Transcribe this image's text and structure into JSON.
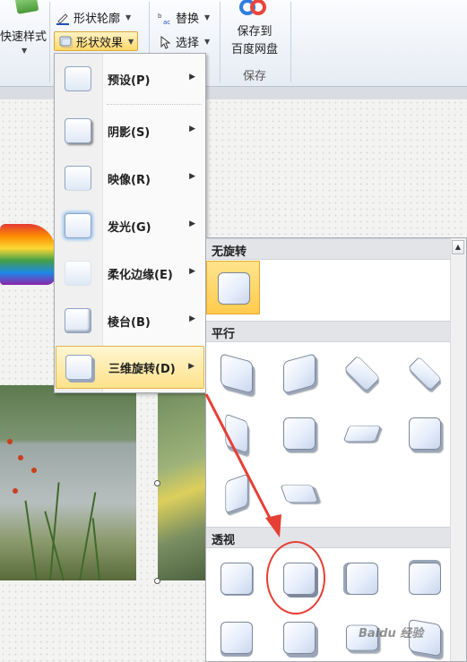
{
  "ribbon": {
    "quick_style": "快速样式",
    "shape_outline": "形状轮廓",
    "shape_effect": "形状效果",
    "replace": "替换",
    "select": "选择",
    "save_to_line1": "保存到",
    "save_to_line2": "百度网盘",
    "save_group": "保存"
  },
  "effects_menu": {
    "items": [
      {
        "label": "预设(P)",
        "icon": "preset-icon"
      },
      {
        "label": "阴影(S)",
        "icon": "shadow-icon"
      },
      {
        "label": "映像(R)",
        "icon": "reflection-icon"
      },
      {
        "label": "发光(G)",
        "icon": "glow-icon"
      },
      {
        "label": "柔化边缘(E)",
        "icon": "soft-edges-icon"
      },
      {
        "label": "棱台(B)",
        "icon": "bevel-icon"
      },
      {
        "label": "三维旋转(D)",
        "icon": "rotation-3d-icon"
      }
    ],
    "active": "三维旋转(D)"
  },
  "rotation_submenu": {
    "sections": [
      {
        "title": "无旋转",
        "count": 1,
        "selected": 0
      },
      {
        "title": "平行",
        "count": 10
      },
      {
        "title": "透视",
        "count": 8,
        "highlighted": 1
      }
    ]
  },
  "watermark": "Baidu 经验",
  "colors": {
    "selected": "#ffcb4d",
    "annotation": "#e53f35",
    "ribbon_bg": "#e6ecf4"
  }
}
